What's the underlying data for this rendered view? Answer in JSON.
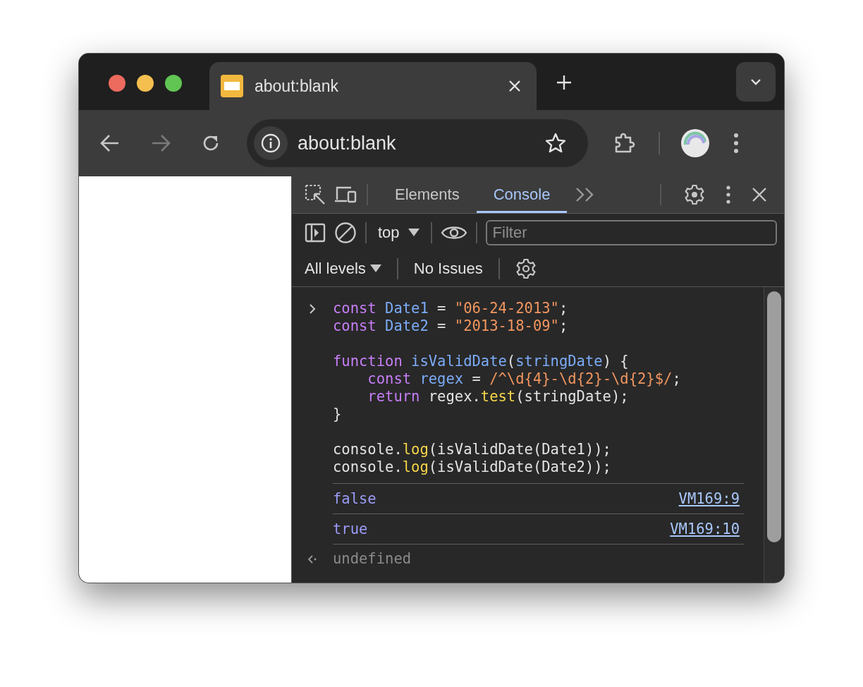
{
  "tab": {
    "title": "about:blank"
  },
  "address_bar": {
    "url": "about:blank"
  },
  "devtools": {
    "tabs": [
      {
        "label": "Elements",
        "selected": false
      },
      {
        "label": "Console",
        "selected": true
      }
    ],
    "context": "top",
    "filter": {
      "placeholder": "Filter"
    },
    "levels": "All levels",
    "issues": "No Issues"
  },
  "console": {
    "input": [
      [
        [
          {
            "kind": "keyword",
            "text": "const"
          },
          {
            "kind": "variable",
            "text": " Date1"
          },
          {
            "kind": "plain",
            "text": " = "
          },
          {
            "kind": "string",
            "text": "\"06-24-2013\""
          },
          {
            "kind": "plain",
            "text": ";"
          }
        ],
        [
          {
            "kind": "keyword",
            "text": "const"
          },
          {
            "kind": "variable",
            "text": " Date2"
          },
          {
            "kind": "plain",
            "text": " = "
          },
          {
            "kind": "string",
            "text": "\"2013-18-09\""
          },
          {
            "kind": "plain",
            "text": ";"
          }
        ]
      ],
      [
        [
          {
            "kind": "keyword",
            "text": "function"
          },
          {
            "kind": "variable",
            "text": " isValidDate"
          },
          {
            "kind": "plain",
            "text": "("
          },
          {
            "kind": "variable",
            "text": "stringDate"
          },
          {
            "kind": "plain",
            "text": ") {"
          }
        ],
        [
          {
            "kind": "keyword",
            "text": "    const"
          },
          {
            "kind": "variable",
            "text": " regex"
          },
          {
            "kind": "plain",
            "text": " = "
          },
          {
            "kind": "string",
            "text": "/^\\d{4}-\\d{2}-\\d{2}$/"
          },
          {
            "kind": "plain",
            "text": ";"
          }
        ],
        [
          {
            "kind": "keyword",
            "text": "    return"
          },
          {
            "kind": "plain",
            "text": " regex."
          },
          {
            "kind": "method",
            "text": "test"
          },
          {
            "kind": "plain",
            "text": "(stringDate);"
          }
        ],
        [
          {
            "kind": "plain",
            "text": "}"
          }
        ]
      ],
      [
        [
          {
            "kind": "plain",
            "text": "console."
          },
          {
            "kind": "method",
            "text": "log"
          },
          {
            "kind": "plain",
            "text": "(isValidDate(Date1));"
          }
        ],
        [
          {
            "kind": "plain",
            "text": "console."
          },
          {
            "kind": "method",
            "text": "log"
          },
          {
            "kind": "plain",
            "text": "(isValidDate(Date2));"
          }
        ]
      ]
    ],
    "messages": [
      {
        "text": "false",
        "source": "VM169:9"
      },
      {
        "text": "true",
        "source": "VM169:10"
      }
    ],
    "result": "undefined"
  }
}
